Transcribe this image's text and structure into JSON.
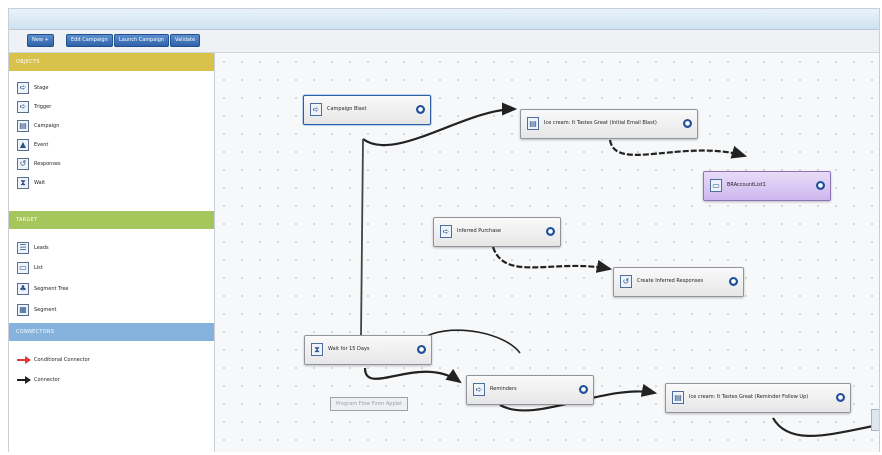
{
  "toolbar": {
    "buttons": [
      "New +",
      "Edit Campaign",
      "Launch Campaign",
      "Validate"
    ]
  },
  "palette": {
    "objects_header": "OBJECTS",
    "objects": [
      {
        "label": "Stage",
        "icon": "stage-arrow-icon"
      },
      {
        "label": "Trigger",
        "icon": "trigger-icon"
      },
      {
        "label": "Campaign",
        "icon": "campaign-icon"
      },
      {
        "label": "Event",
        "icon": "event-icon"
      },
      {
        "label": "Responses",
        "icon": "responses-icon"
      },
      {
        "label": "Wait",
        "icon": "hourglass-icon"
      }
    ],
    "target_header": "TARGET",
    "target": [
      {
        "label": "Leads",
        "icon": "leads-icon"
      },
      {
        "label": "List",
        "icon": "list-icon"
      },
      {
        "label": "Segment Tree",
        "icon": "segment-tree-icon"
      },
      {
        "label": "Segment",
        "icon": "segment-icon"
      }
    ],
    "connectors_header": "CONNECTORS",
    "connectors": [
      {
        "label": "Conditional Connector",
        "color": "#e03a3a"
      },
      {
        "label": "Connector",
        "color": "#222222"
      }
    ]
  },
  "nodes": {
    "campaign_blast": "Campaign Blast",
    "initial_email": "Ice cream: It Tastes Great (Initial Email Blast)",
    "account_list": "BRAccountList1",
    "inferred_purchase": "Inferred Purchase",
    "create_inferred": "Create Inferred Responses",
    "wait": "Wait for 15 Days",
    "reminders": "Reminders",
    "reminder_email": "Ice cream: It Tastes Great (Reminder Follow Up)"
  },
  "tooltip": "Program Flow Form Applet",
  "colors": {
    "objects_header": "#d9c24a",
    "target_header": "#a5c65b",
    "connectors_header": "#86b3dd",
    "accent": "#1f4f9a",
    "list_node": "#cdb7ef"
  }
}
